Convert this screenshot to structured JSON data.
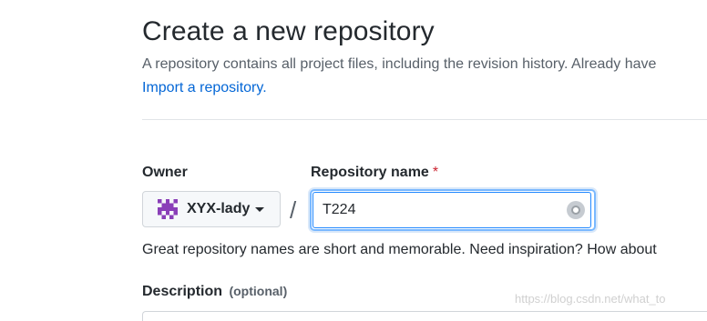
{
  "header": {
    "title": "Create a new repository",
    "subtitle": "A repository contains all project files, including the revision history. Already have",
    "import_link": "Import a repository."
  },
  "form": {
    "owner_label": "Owner",
    "owner_value": "XYX-lady",
    "separator": "/",
    "repo_name_label": "Repository name",
    "required_mark": "*",
    "repo_name_value": "T224",
    "hint": "Great repository names are short and memorable. Need inspiration? How about",
    "description_label": "Description",
    "description_optional": "(optional)"
  },
  "watermark": "https://blog.csdn.net/what_to",
  "colors": {
    "link": "#0366d6",
    "required": "#cb2431",
    "focus_border": "#2188ff",
    "avatar": "#8a3fb8"
  },
  "icons": {
    "owner_avatar": "identicon-avatar",
    "dropdown": "caret-down-icon",
    "input_extension": "grammarly-icon"
  }
}
